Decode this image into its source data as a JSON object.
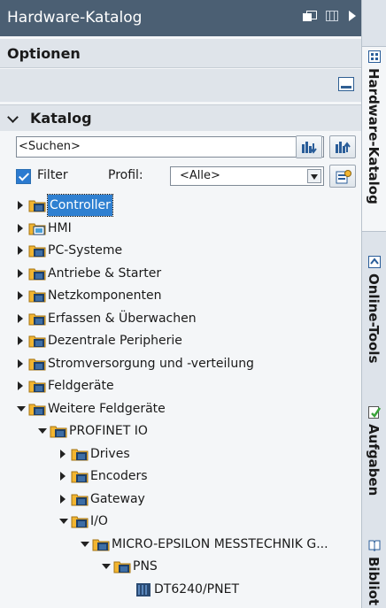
{
  "panel": {
    "title": "Hardware-Katalog",
    "options_heading": "Optionen",
    "catalog_heading": "Katalog"
  },
  "search": {
    "value": "<Suchen>"
  },
  "filter": {
    "label": "Filter",
    "checked": true,
    "profile_label": "Profil:",
    "profile_value": "<Alle>"
  },
  "tree": [
    {
      "label": "Controller",
      "selected": true
    },
    {
      "label": "HMI"
    },
    {
      "label": "PC-Systeme"
    },
    {
      "label": "Antriebe & Starter"
    },
    {
      "label": "Netzkomponenten"
    },
    {
      "label": "Erfassen & Überwachen"
    },
    {
      "label": "Dezentrale Peripherie"
    },
    {
      "label": "Stromversorgung und -verteilung"
    },
    {
      "label": "Feldgeräte"
    },
    {
      "label": "Weitere Feldgeräte"
    },
    {
      "label": "PROFINET IO"
    },
    {
      "label": "Drives"
    },
    {
      "label": "Encoders"
    },
    {
      "label": "Gateway"
    },
    {
      "label": "I/O"
    },
    {
      "label": "MICRO-EPSILON MESSTECHNIK G..."
    },
    {
      "label": "PNS"
    },
    {
      "label": "DT6240/PNET"
    }
  ],
  "side_tabs": [
    {
      "label": "Hardware-Katalog",
      "active": true
    },
    {
      "label": "Online-Tools"
    },
    {
      "label": "Aufgaben"
    },
    {
      "label": "Bibliot"
    }
  ]
}
